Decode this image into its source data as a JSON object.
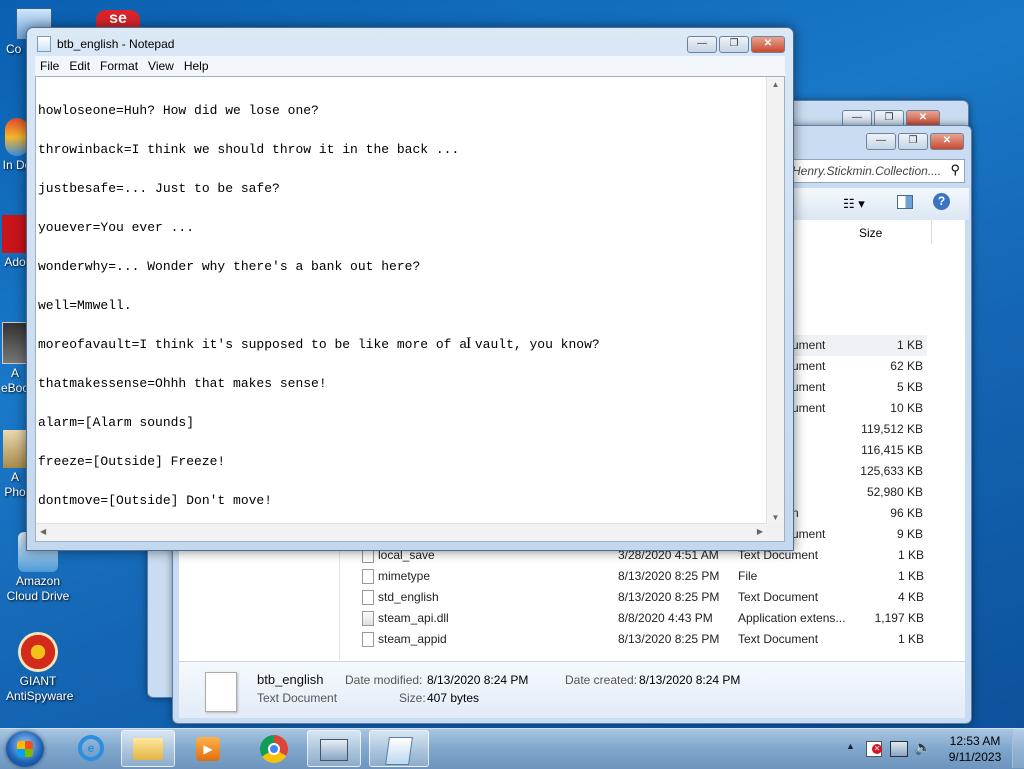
{
  "desktop": {
    "icons": [
      {
        "label": "Co"
      },
      {
        "label": "In Do"
      },
      {
        "label": "Ado"
      },
      {
        "label": "A eBoo"
      },
      {
        "label": "A Pho"
      },
      {
        "label": "Amazon Cloud Drive"
      },
      {
        "label": "GIANT AntiSpyware"
      }
    ]
  },
  "explorer": {
    "address_tail": "Henry.Stickmin.Collection....",
    "column_size": "Size",
    "partial_rows": [
      {
        "type": "ument",
        "size": "1 KB"
      },
      {
        "type": "ument",
        "size": "62 KB"
      },
      {
        "type": "ument",
        "size": "5 KB"
      },
      {
        "type": "ument",
        "size": "10 KB"
      },
      {
        "type": "",
        "size": "119,512 KB"
      },
      {
        "type": "",
        "size": "116,415 KB"
      },
      {
        "type": "",
        "size": "125,633 KB"
      },
      {
        "type": "",
        "size": "52,980 KB"
      },
      {
        "type": "n",
        "size": "96 KB"
      },
      {
        "type": "ument",
        "size": "9 KB"
      }
    ],
    "files": [
      {
        "name": "local_save",
        "date": "3/28/2020 4:51 AM",
        "type": "Text Document",
        "size": "1 KB"
      },
      {
        "name": "mimetype",
        "date": "8/13/2020 8:25 PM",
        "type": "File",
        "size": "1 KB"
      },
      {
        "name": "std_english",
        "date": "8/13/2020 8:25 PM",
        "type": "Text Document",
        "size": "4 KB"
      },
      {
        "name": "steam_api.dll",
        "date": "8/8/2020 4:43 PM",
        "type": "Application extens...",
        "size": "1,197 KB"
      },
      {
        "name": "steam_appid",
        "date": "8/13/2020 8:25 PM",
        "type": "Text Document",
        "size": "1 KB"
      }
    ],
    "details": {
      "name": "btb_english",
      "kind": "Text Document",
      "modified_label": "Date modified:",
      "modified": "8/13/2020 8:24 PM",
      "created_label": "Date created:",
      "created": "8/13/2020 8:24 PM",
      "size_label": "Size:",
      "size": "407 bytes"
    }
  },
  "notepad": {
    "title": "btb_english - Notepad",
    "menu": [
      "File",
      "Edit",
      "Format",
      "View",
      "Help"
    ],
    "lines": [
      "howloseone=Huh? How did we lose one?",
      "throwinback=I think we should throw it in the back ...",
      "justbesafe=... Just to be safe?",
      "youever=You ever ...",
      "wonderwhy=... Wonder why there's a bank out here?",
      "well=Mmwell.",
      "moreofavault=I think it's supposed to be like more of a vault, you know?",
      "thatmakessense=Ohhh that makes sense!",
      "alarm=[Alarm sounds]",
      "freeze=[Outside] Freeze!",
      "dontmove=[Outside] Don't move!"
    ]
  },
  "taskbar": {
    "time": "12:53 AM",
    "date": "9/11/2023"
  }
}
